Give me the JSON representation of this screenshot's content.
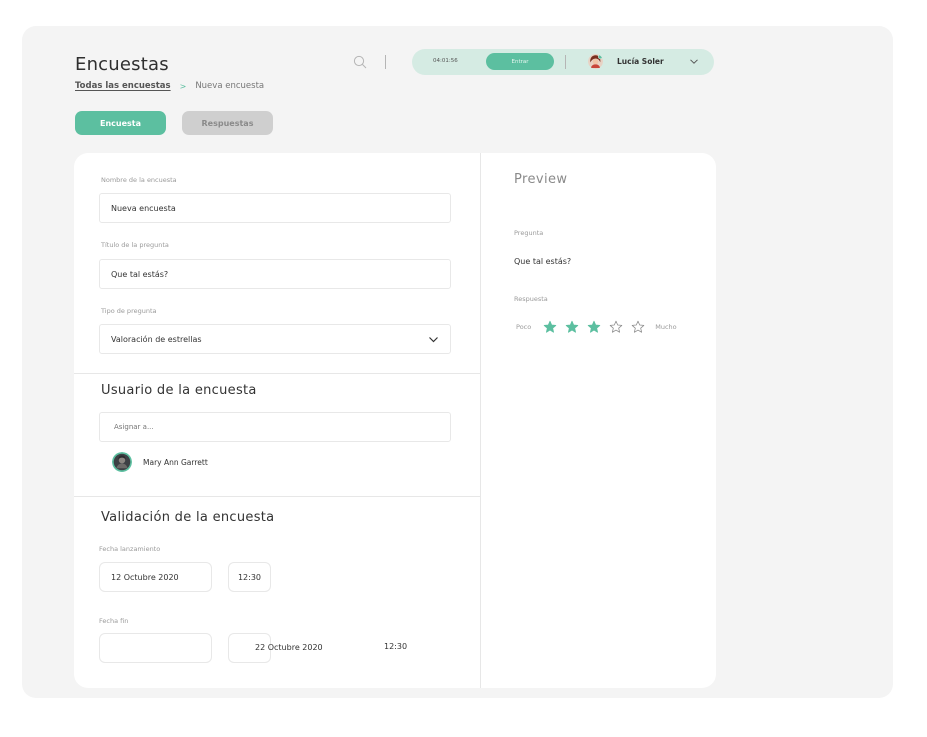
{
  "header": {
    "title": "Encuestas",
    "breadcrumb": {
      "link": "Todas las encuestas",
      "separator": ">",
      "current": "Nueva encuesta"
    },
    "timer": "04:01:56",
    "enter_label": "Entrar",
    "user": {
      "name": "Lucía Soler",
      "avatar": "user-avatar"
    }
  },
  "tabs": [
    {
      "label": "Encuesta",
      "active": true
    },
    {
      "label": "Respuestas",
      "active": false
    }
  ],
  "form": {
    "survey_name": {
      "label": "Nombre de la encuesta",
      "value": "Nueva encuesta"
    },
    "question_title": {
      "label": "Título de la pregunta",
      "value": "Que tal estás?"
    },
    "question_type": {
      "label": "Tipo de pregunta",
      "value": "Valoración de estrellas"
    }
  },
  "users_section": {
    "title": "Usuario de la encuesta",
    "assign_placeholder": "Asignar a...",
    "assigned": [
      {
        "name": "Mary Ann Garrett"
      }
    ]
  },
  "validation_section": {
    "title": "Validación de la encuesta",
    "start": {
      "label": "Fecha lanzamiento",
      "date": "12 Octubre 2020",
      "time": "12:30"
    },
    "end": {
      "label": "Fecha fin",
      "date": "22 Octubre 2020",
      "time": "12:30"
    }
  },
  "preview": {
    "title": "Preview",
    "question_label": "Pregunta",
    "question": "Que tal estás?",
    "answer_label": "Respuesta",
    "low_label": "Poco",
    "high_label": "Mucho",
    "rating": 3,
    "max_rating": 5
  },
  "colors": {
    "accent": "#5cbfa0",
    "accent_light": "#d5ebe3",
    "tab_inactive": "#cfcfcf"
  }
}
